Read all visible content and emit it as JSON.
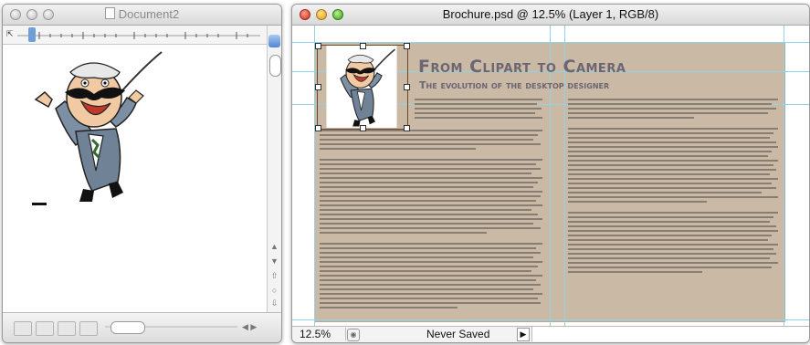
{
  "left_window": {
    "title": "Document2"
  },
  "right_window": {
    "title": "Brochure.psd @ 12.5% (Layer 1, RGB/8)",
    "document": {
      "headline": "From Clipart to Camera",
      "subhead": "The evolution of the desktop designer"
    },
    "status_bar": {
      "zoom": "12.5%",
      "save_state": "Never Saved"
    }
  },
  "colors": {
    "brochure_background": "#c9b9a5",
    "headline_text": "#6b6672",
    "guide_lines": "#8fd3e6"
  }
}
